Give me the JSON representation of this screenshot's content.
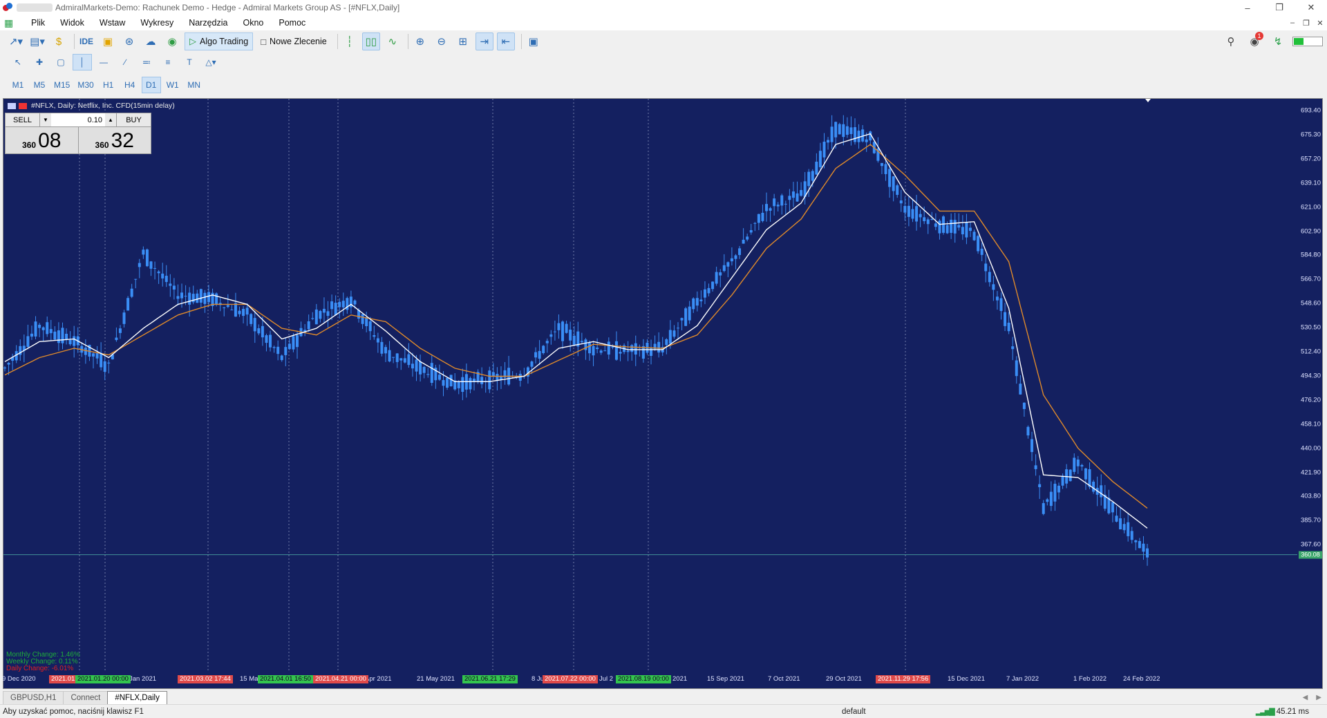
{
  "window": {
    "title": "AdmiralMarkets-Demo: Rachunek Demo - Hedge - Admiral Markets Group AS - [#NFLX,Daily]",
    "controls": [
      "minimize",
      "restore",
      "close"
    ]
  },
  "menu": {
    "items": [
      "Plik",
      "Widok",
      "Wstaw",
      "Wykresy",
      "Narzędzia",
      "Okno",
      "Pomoc"
    ]
  },
  "toolbar": {
    "ide_label": "IDE",
    "algo_trading_label": "Algo Trading",
    "new_order_label": "Nowe Zlecenie",
    "notifications_count": "1"
  },
  "timeframes": [
    "M1",
    "M5",
    "M15",
    "M30",
    "H1",
    "H4",
    "D1",
    "W1",
    "MN"
  ],
  "active_timeframe": "D1",
  "chart": {
    "caption": "#NFLX, Daily:  Netflix, Inc. CFD(15min delay)",
    "trade_panel": {
      "sell_label": "SELL",
      "buy_label": "BUY",
      "lot": "0.10",
      "sell_small": "360",
      "sell_big": "08",
      "buy_small": "360",
      "buy_big": "32"
    },
    "change_labels": {
      "monthly": "Monthly Change: 1.46%",
      "weekly": "Weekly Change: 0.11%",
      "daily": "Daily Change: -6.01%"
    },
    "current_price": "360.08",
    "colors": {
      "background": "#142060",
      "candle": "#3a8ef6",
      "ma_fast": "#ffffff",
      "ma_slow": "#e08a2a"
    }
  },
  "chart_data": {
    "type": "line",
    "title": "#NFLX, Daily",
    "price_ticks": [
      "693.40",
      "675.30",
      "657.20",
      "639.10",
      "621.00",
      "602.90",
      "584.80",
      "566.70",
      "548.60",
      "530.50",
      "512.40",
      "494.30",
      "476.20",
      "458.10",
      "440.00",
      "421.90",
      "403.80",
      "385.70",
      "367.60"
    ],
    "time_ticks": [
      "9 Dec 2020",
      "Jan 2021",
      "15 Mar",
      "Apr 2021",
      "21 May 2021",
      "8 Ju",
      "Jul 2",
      "2021",
      "15 Sep 2021",
      "7 Oct 2021",
      "29 Oct 2021",
      "15 Dec 2021",
      "7 Jan 2022",
      "1 Feb 2022",
      "24 Feb 2022"
    ],
    "event_tags": [
      {
        "label": "2021.01.",
        "color": "red"
      },
      {
        "label": "2021.01.20 00:00",
        "color": "green"
      },
      {
        "label": "2021.03.02 17:44",
        "color": "red"
      },
      {
        "label": "2021.04.01 16:50",
        "color": "green"
      },
      {
        "label": "2021.04.21 00:00",
        "color": "red"
      },
      {
        "label": "2021.06.21 17:29",
        "color": "green"
      },
      {
        "label": "2021.07.22 00:00",
        "color": "red"
      },
      {
        "label": "2021.08.19 00:00",
        "color": "green"
      },
      {
        "label": "2021.11.29 17:56",
        "color": "red"
      }
    ],
    "ylim": [
      360,
      700
    ],
    "series": [
      {
        "x": [
          "2020-12-09",
          "2020-12-23",
          "2021-01-08",
          "2021-01-19",
          "2021-01-21",
          "2021-02-05",
          "2021-02-19",
          "2021-03-02",
          "2021-03-16",
          "2021-03-31",
          "2021-04-14",
          "2021-04-21",
          "2021-05-06",
          "2021-05-20",
          "2021-06-04",
          "2021-06-21",
          "2021-07-06",
          "2021-07-20",
          "2021-08-04",
          "2021-08-19",
          "2021-09-03",
          "2021-09-17",
          "2021-10-01",
          "2021-10-15",
          "2021-10-29",
          "2021-11-12",
          "2021-11-26",
          "2021-12-10",
          "2021-12-27",
          "2022-01-11",
          "2022-01-21",
          "2022-02-04",
          "2022-02-18",
          "2022-03-04"
        ],
        "values": [
          500,
          532,
          520,
          502,
          586,
          555,
          552,
          540,
          508,
          540,
          552,
          512,
          500,
          488,
          492,
          496,
          530,
          515,
          513,
          515,
          550,
          580,
          620,
          630,
          680,
          672,
          620,
          608,
          602,
          530,
          395,
          430,
          393,
          360
        ]
      },
      {
        "values": [
          505,
          520,
          522,
          508,
          530,
          548,
          555,
          548,
          522,
          530,
          548,
          528,
          505,
          490,
          490,
          494,
          515,
          520,
          514,
          514,
          532,
          568,
          604,
          624,
          668,
          676,
          632,
          608,
          610,
          545,
          420,
          418,
          400,
          380
        ]
      },
      {
        "values": [
          495,
          508,
          515,
          510,
          525,
          540,
          548,
          548,
          530,
          525,
          540,
          535,
          515,
          500,
          494,
          494,
          506,
          518,
          516,
          515,
          525,
          555,
          590,
          612,
          650,
          668,
          645,
          618,
          618,
          580,
          480,
          440,
          415,
          395
        ]
      }
    ]
  }
}
